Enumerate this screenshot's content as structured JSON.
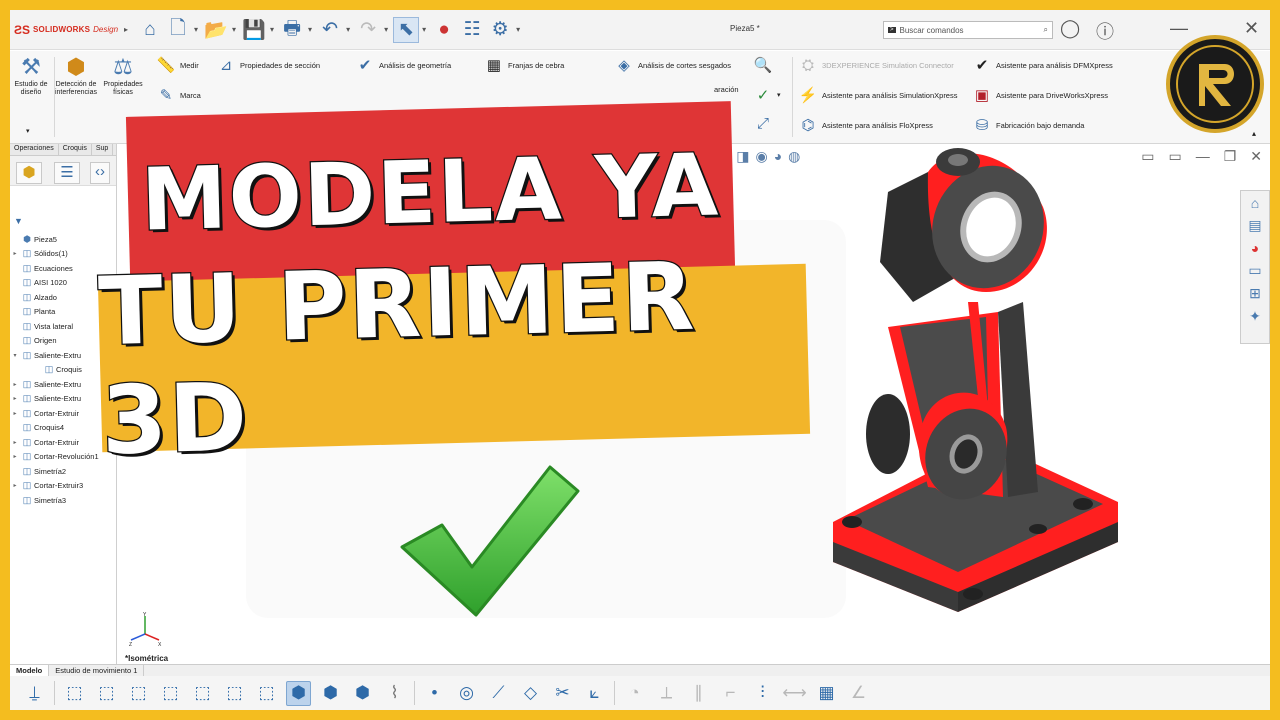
{
  "app": {
    "brand": "SOLIDWORKS",
    "edition": "Design",
    "doc_name": "Pieza5 *"
  },
  "search": {
    "placeholder": "Buscar comandos"
  },
  "ribbon": {
    "big": [
      {
        "label": "Estudio de diseño",
        "icon": "design-study-icon"
      },
      {
        "label": "Detección de interferencias",
        "icon": "interference-icon"
      },
      {
        "label": "Propiedades físicas",
        "icon": "mass-properties-icon"
      }
    ],
    "col1": [
      "Medir",
      "Marca"
    ],
    "col2": [
      "Propiedades de sección"
    ],
    "col3": [
      "Análisis de geometría"
    ],
    "col4": [
      "Franjas de cebra"
    ],
    "col5": [
      "Análisis de cortes sesgados",
      "aración"
    ],
    "col6": [
      "3DEXPERIENCE Simulation Connector",
      "Asistente para análisis SimulationXpress",
      "Asistente para análisis FloXpress"
    ],
    "col7": [
      "Asistente para análisis DFMXpress",
      "Asistente para DriveWorksXpress",
      "Fabricación bajo demanda"
    ]
  },
  "panel": {
    "tabs": [
      "Operaciones",
      "Croquis",
      "Sup"
    ],
    "tree": [
      {
        "label": "Pieza5",
        "expand": "",
        "indent": 0
      },
      {
        "label": "Sólidos(1)",
        "expand": "▸",
        "indent": 1
      },
      {
        "label": "Ecuaciones",
        "expand": "",
        "indent": 1
      },
      {
        "label": "AISI 1020",
        "expand": "",
        "indent": 1
      },
      {
        "label": "Alzado",
        "expand": "",
        "indent": 1
      },
      {
        "label": "Planta",
        "expand": "",
        "indent": 1
      },
      {
        "label": "Vista lateral",
        "expand": "",
        "indent": 1
      },
      {
        "label": "Origen",
        "expand": "",
        "indent": 1
      },
      {
        "label": "Saliente-Extru",
        "expand": "▾",
        "indent": 1
      },
      {
        "label": "Croquis",
        "expand": "",
        "indent": 2
      },
      {
        "label": "Saliente-Extru",
        "expand": "▸",
        "indent": 1
      },
      {
        "label": "Saliente-Extru",
        "expand": "▸",
        "indent": 1
      },
      {
        "label": "Cortar-Extruir",
        "expand": "▸",
        "indent": 1
      },
      {
        "label": "Croquis4",
        "expand": "",
        "indent": 1
      },
      {
        "label": "Cortar-Extruir",
        "expand": "▸",
        "indent": 1
      },
      {
        "label": "Cortar-Revolución1",
        "expand": "▸",
        "indent": 1
      },
      {
        "label": "Simetría2",
        "expand": "",
        "indent": 1
      },
      {
        "label": "Cortar-Extruir3",
        "expand": "▸",
        "indent": 1
      },
      {
        "label": "Simetría3",
        "expand": "",
        "indent": 1
      }
    ]
  },
  "viewport": {
    "view_name": "*Isométrica"
  },
  "bottom_tabs": [
    "Modelo",
    "Estudio de movimiento 1"
  ],
  "overlay": {
    "line1": "MODELA YA",
    "line2": "TU PRIMER 3D"
  },
  "colors": {
    "red_banner": "#df3536",
    "gold_banner": "#f2b52a",
    "frame": "#f4bd1f",
    "check": "#5ac34a",
    "edge_red": "#ff1f1f"
  }
}
